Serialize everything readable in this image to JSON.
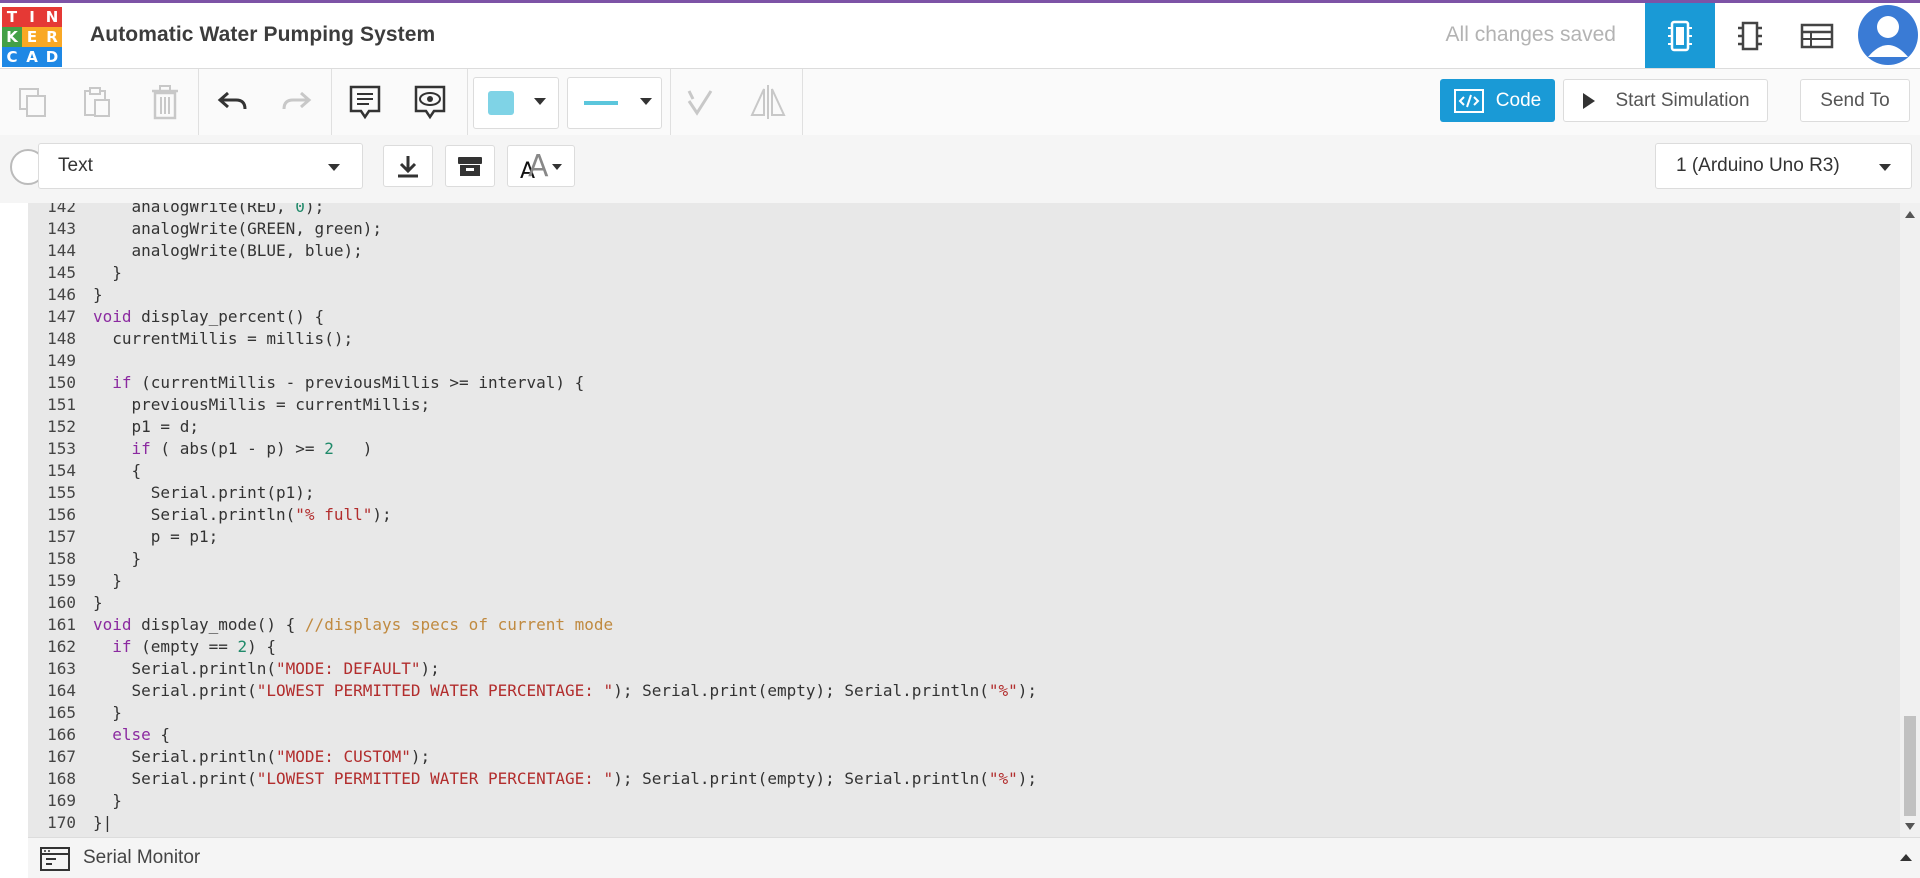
{
  "header": {
    "logo_letters": [
      "T",
      "I",
      "N",
      "K",
      "E",
      "R",
      "C",
      "A",
      "D"
    ],
    "logo_colors": [
      "#e53935",
      "#e53935",
      "#e53935",
      "#43a047",
      "#f9a825",
      "#f9a825",
      "#1e88e5",
      "#1e88e5",
      "#1e88e5"
    ],
    "title": "Automatic Water Pumping System",
    "status": "All changes saved",
    "buttons": [
      "circuit-view-icon",
      "schematic-view-icon",
      "component-list-icon"
    ]
  },
  "toolbar": {
    "code_label": "Code",
    "sim_label": "Start Simulation",
    "send_label": "Send To",
    "fill_color": "#7fd3e6",
    "accent": "#1a9ad6"
  },
  "codebar": {
    "mode": "Text",
    "device": "1 (Arduino Uno R3)"
  },
  "serial_monitor": {
    "label": "Serial Monitor"
  },
  "code_lines": [
    {
      "n": "142",
      "html": "    analogWrite(RED, <span class=\"num\">0</span>);"
    },
    {
      "n": "143",
      "html": "    analogWrite(GREEN, green);"
    },
    {
      "n": "144",
      "html": "    analogWrite(BLUE, blue);"
    },
    {
      "n": "145",
      "html": "  }"
    },
    {
      "n": "146",
      "html": "}"
    },
    {
      "n": "147",
      "html": "<span class=\"kw\">void</span> display_percent() {"
    },
    {
      "n": "148",
      "html": "  currentMillis = millis();"
    },
    {
      "n": "149",
      "html": ""
    },
    {
      "n": "150",
      "html": "  <span class=\"kw\">if</span> (currentMillis - previousMillis >= interval) {"
    },
    {
      "n": "151",
      "html": "    previousMillis = currentMillis;"
    },
    {
      "n": "152",
      "html": "    p1 = d;"
    },
    {
      "n": "153",
      "html": "    <span class=\"kw\">if</span> ( abs(p1 - p) >= <span class=\"num\">2</span>   )"
    },
    {
      "n": "154",
      "html": "    {"
    },
    {
      "n": "155",
      "html": "      Serial.print(p1);"
    },
    {
      "n": "156",
      "html": "      Serial.println(<span class=\"str\">\"% full\"</span>);"
    },
    {
      "n": "157",
      "html": "      p = p1;"
    },
    {
      "n": "158",
      "html": "    }"
    },
    {
      "n": "159",
      "html": "  }"
    },
    {
      "n": "160",
      "html": "}"
    },
    {
      "n": "161",
      "html": "<span class=\"kw\">void</span> display_mode() { <span class=\"cm\">//displays specs of current mode</span>"
    },
    {
      "n": "162",
      "html": "  <span class=\"kw\">if</span> (empty == <span class=\"num\">2</span>) {"
    },
    {
      "n": "163",
      "html": "    Serial.println(<span class=\"str\">\"MODE: DEFAULT\"</span>);"
    },
    {
      "n": "164",
      "html": "    Serial.print(<span class=\"str\">\"LOWEST PERMITTED WATER PERCENTAGE: \"</span>); Serial.print(empty); Serial.println(<span class=\"str\">\"%\"</span>);"
    },
    {
      "n": "165",
      "html": "  }"
    },
    {
      "n": "166",
      "html": "  <span class=\"kw\">else</span> {"
    },
    {
      "n": "167",
      "html": "    Serial.println(<span class=\"str\">\"MODE: CUSTOM\"</span>);"
    },
    {
      "n": "168",
      "html": "    Serial.print(<span class=\"str\">\"LOWEST PERMITTED WATER PERCENTAGE: \"</span>); Serial.print(empty); Serial.println(<span class=\"str\">\"%\"</span>);"
    },
    {
      "n": "169",
      "html": "  }"
    },
    {
      "n": "170",
      "html": "}|"
    }
  ]
}
